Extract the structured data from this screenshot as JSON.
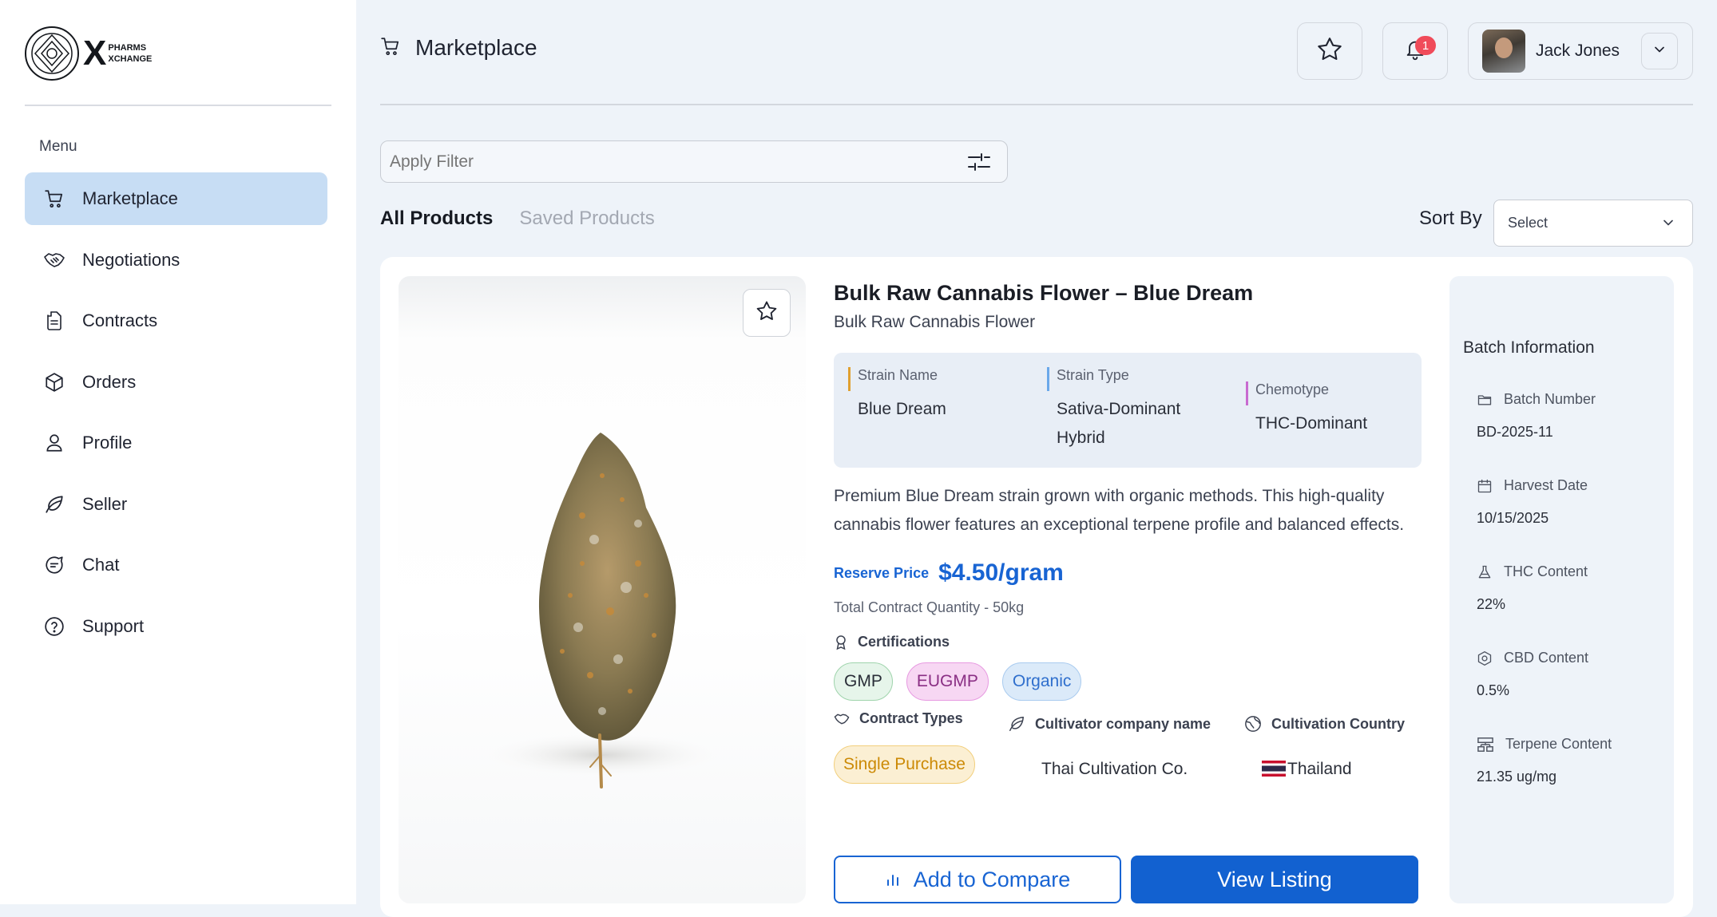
{
  "brand": {
    "logo_line1": "PHARMS",
    "logo_line2": "XCHANGE"
  },
  "sidebar": {
    "menu_label": "Menu",
    "items": [
      {
        "label": "Marketplace",
        "icon": "cart-icon",
        "active": true
      },
      {
        "label": "Negotiations",
        "icon": "handshake-icon"
      },
      {
        "label": "Contracts",
        "icon": "document-icon"
      },
      {
        "label": "Orders",
        "icon": "box-icon"
      },
      {
        "label": "Profile",
        "icon": "user-icon"
      },
      {
        "label": "Seller",
        "icon": "leaf-icon"
      },
      {
        "label": "Chat",
        "icon": "chat-icon"
      },
      {
        "label": "Support",
        "icon": "help-icon"
      }
    ]
  },
  "header": {
    "title": "Marketplace",
    "notification_count": "1",
    "user_name": "Jack Jones"
  },
  "filter": {
    "placeholder": "Apply Filter"
  },
  "tabs": {
    "all": "All Products",
    "saved": "Saved Products"
  },
  "sort": {
    "label": "Sort By",
    "value": "Select"
  },
  "product": {
    "title": "Bulk Raw Cannabis Flower – Blue Dream",
    "subtitle": "Bulk Raw Cannabis Flower",
    "attributes": {
      "strain_name_label": "Strain Name",
      "strain_name": "Blue Dream",
      "strain_type_label": "Strain Type",
      "strain_type": "Sativa-Dominant Hybrid",
      "chemotype_label": "Chemotype",
      "chemotype": "THC-Dominant"
    },
    "description": "Premium Blue Dream strain grown with organic methods. This high-quality cannabis flower features an exceptional terpene profile and balanced effects.",
    "reserve_label": "Reserve Price",
    "price": "$4.50/gram",
    "quantity": "Total Contract Quantity - 50kg",
    "certifications_label": "Certifications",
    "certifications": [
      "GMP",
      "EUGMP",
      "Organic"
    ],
    "contract_types_label": "Contract Types",
    "contract_type": "Single Purchase",
    "cultivator_label": "Cultivator company name",
    "cultivator": "Thai Cultivation Co.",
    "country_label": "Cultivation Country",
    "country": "Thailand",
    "add_compare": "Add to Compare",
    "view_listing": "View Listing"
  },
  "batch": {
    "title": "Batch Information",
    "batch_number_label": "Batch Number",
    "batch_number": "BD-2025-11",
    "harvest_date_label": "Harvest Date",
    "harvest_date": "10/15/2025",
    "thc_label": "THC Content",
    "thc": "22%",
    "cbd_label": "CBD Content",
    "cbd": "0.5%",
    "terpene_label": "Terpene Content",
    "terpene": "21.35 ug/mg"
  },
  "colors": {
    "accent": "#1864d3",
    "active_nav": "#c7ddf4",
    "badge": "#f04b5a"
  }
}
